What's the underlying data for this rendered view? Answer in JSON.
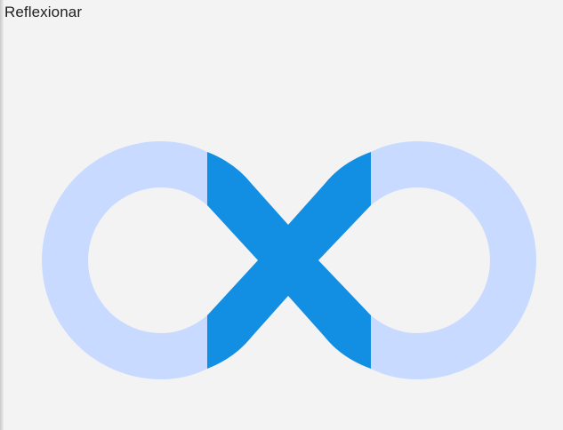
{
  "header": {
    "title": "Reflexionar"
  },
  "graphic": {
    "icon": "infinity-loop-icon",
    "colors": {
      "loop_light": "#c8daff",
      "cross_dark": "#128fe3"
    }
  }
}
